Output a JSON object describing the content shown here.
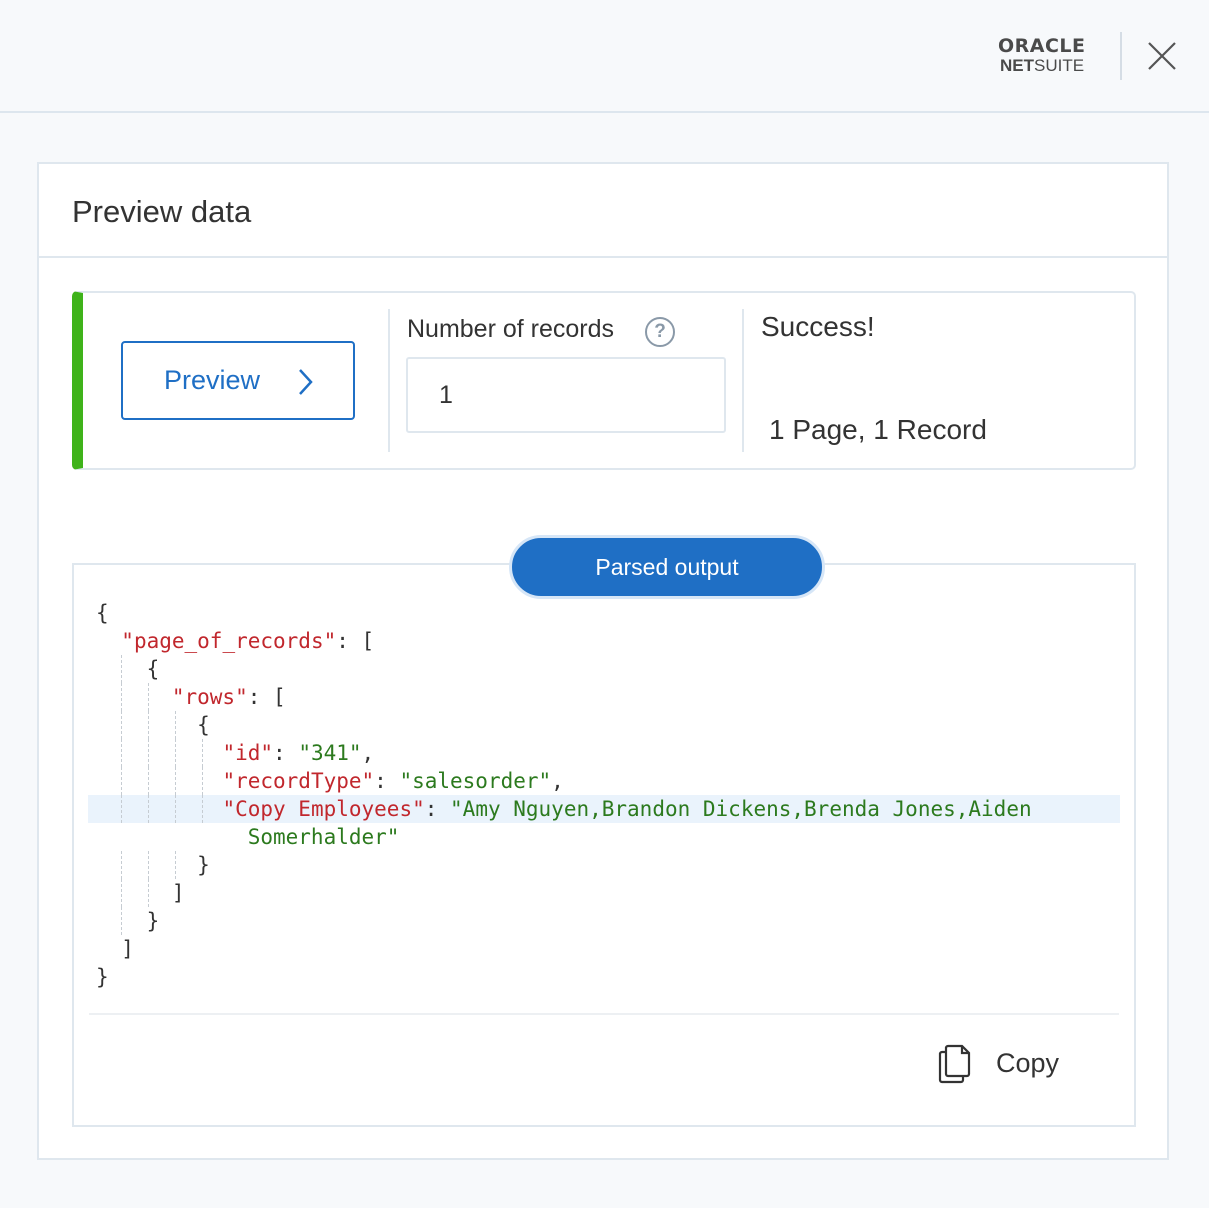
{
  "header": {
    "logo_oracle": "ORACLE",
    "logo_netsuite_bold": "NET",
    "logo_netsuite_rest": "SUITE"
  },
  "panel": {
    "title": "Preview data"
  },
  "status": {
    "preview_label": "Preview",
    "records_label": "Number of records",
    "help_symbol": "?",
    "records_value": "1",
    "success_title": "Success!",
    "success_detail": "1 Page, 1 Record",
    "accent_color": "#3fb31a"
  },
  "output": {
    "tab_label": "Parsed output",
    "copy_label": "Copy",
    "code": {
      "open": "{",
      "key_page": "\"page_of_records\"",
      "open_arr": "[",
      "open_obj": "{",
      "key_rows": "\"rows\"",
      "key_id": "\"id\"",
      "val_id": "\"341\"",
      "key_type": "\"recordType\"",
      "val_type": "\"salesorder\"",
      "key_copy": "\"Copy Employees\"",
      "val_copy_1": "\"Amy Nguyen,Brandon Dickens,Brenda Jones,Aiden",
      "val_copy_2": "Somerhalder\"",
      "close_obj": "}",
      "close_arr": "]",
      "close": "}"
    }
  },
  "colors": {
    "primary": "#1f6fc5",
    "json_key": "#c1272d",
    "json_string": "#2c7a1e"
  }
}
